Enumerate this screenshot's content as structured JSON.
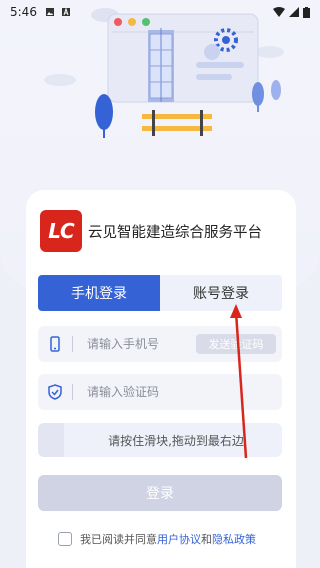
{
  "status_bar": {
    "time": "5:46",
    "icons": [
      "image-icon",
      "a-icon",
      "wifi-icon",
      "signal-icon",
      "battery-icon"
    ]
  },
  "brand": {
    "logo_text": "LC",
    "name": "云见智能建造综合服务平台",
    "logo_color": "#d9261c"
  },
  "tabs": [
    {
      "label": "手机登录",
      "active": true
    },
    {
      "label": "账号登录",
      "active": false
    }
  ],
  "form": {
    "phone_placeholder": "请输入手机号",
    "send_code_label": "发送验证码",
    "code_placeholder": "请输入验证码",
    "slider_text": "请按住滑块,拖动到最右边",
    "login_label": "登录"
  },
  "agreement": {
    "prefix": "我已阅读并同意",
    "user_agreement": "用户协议",
    "and": "和",
    "privacy_policy": "隐私政策"
  },
  "colors": {
    "accent": "#3563d6",
    "annotation_arrow": "#d9261c"
  }
}
